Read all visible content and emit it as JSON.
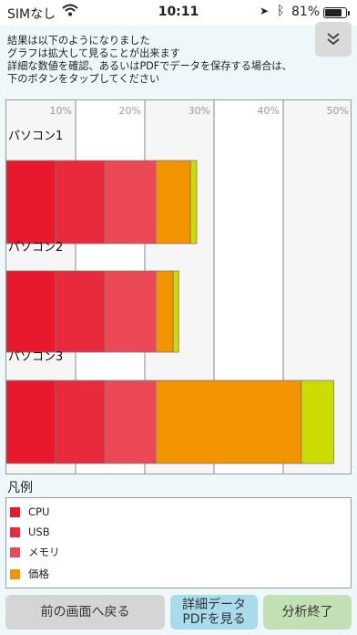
{
  "status_bar": {
    "carrier": "SIMなし",
    "time": "10:11",
    "battery": "81%",
    "battery_level": 0.81
  },
  "intro_lines": [
    "結果は以下のようになりました",
    "グラフは拡大して見ることが出来ます",
    "詳細な数値を確認、あるいはPDFでデータを保存する場合は、",
    "下のボタンをタップしてください"
  ],
  "colors": {
    "cpu": "#e8192c",
    "usb": "#e82a3c",
    "memory": "#eb4956",
    "price": "#f29400",
    "other": "#cddc00"
  },
  "chart_data": {
    "type": "bar",
    "orientation": "horizontal",
    "stacked": true,
    "x_ticks": [
      "10%",
      "20%",
      "30%",
      "40%",
      "50%"
    ],
    "xlim": [
      0,
      50
    ],
    "categories": [
      "パソコン1",
      "パソコン2",
      "パソコン3"
    ],
    "series": [
      {
        "key": "cpu",
        "values": [
          7.1,
          7.1,
          7.1
        ]
      },
      {
        "key": "usb",
        "values": [
          7.1,
          7.1,
          7.1
        ]
      },
      {
        "key": "memory",
        "values": [
          7.4,
          7.4,
          7.4
        ]
      },
      {
        "key": "price",
        "values": [
          5.0,
          2.5,
          21.0
        ]
      },
      {
        "key": "other",
        "values": [
          0.9,
          0.8,
          4.7
        ]
      }
    ],
    "grid": true
  },
  "legend": {
    "title": "凡例",
    "items": [
      {
        "label": "CPU",
        "color": "#e8192c"
      },
      {
        "label": "USB",
        "color": "#e82a3c"
      },
      {
        "label": "メモリ",
        "color": "#eb4956"
      },
      {
        "label": "価格",
        "color": "#f29400"
      }
    ]
  },
  "buttons": {
    "back": "前の画面へ戻る",
    "pdf_line1": "詳細データ",
    "pdf_line2": "PDFを見る",
    "end": "分析終了"
  }
}
